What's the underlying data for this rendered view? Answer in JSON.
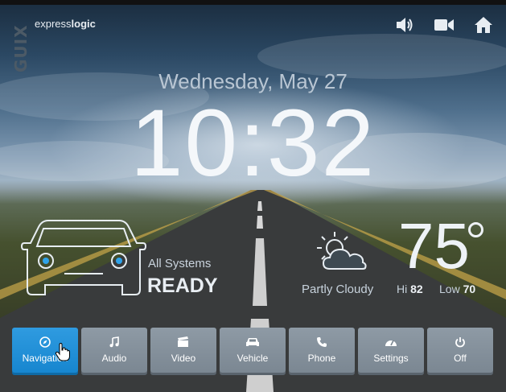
{
  "brand": {
    "badge": "GUIX",
    "name_regular": "express",
    "name_bold": "logic"
  },
  "top_icons": [
    "volume-icon",
    "video-camera-icon",
    "home-icon"
  ],
  "date_text": "Wednesday, May 27",
  "time": {
    "hours": "10",
    "separator": ":",
    "minutes": "32"
  },
  "vehicle_status": {
    "label": "All Systems",
    "status": "READY"
  },
  "weather": {
    "condition": "Partly Cloudy",
    "temperature": "75",
    "hi_label": "Hi",
    "hi_value": "82",
    "lo_label": "Low",
    "lo_value": "70"
  },
  "nav": [
    {
      "label": "Navigation",
      "icon": "compass-icon",
      "active": true
    },
    {
      "label": "Audio",
      "icon": "music-note-icon",
      "active": false
    },
    {
      "label": "Video",
      "icon": "clapperboard-icon",
      "active": false
    },
    {
      "label": "Vehicle",
      "icon": "car-icon",
      "active": false
    },
    {
      "label": "Phone",
      "icon": "phone-icon",
      "active": false
    },
    {
      "label": "Settings",
      "icon": "gauge-icon",
      "active": false
    },
    {
      "label": "Off",
      "icon": "power-icon",
      "active": false
    }
  ],
  "colors": {
    "accent": "#1786cf",
    "button": "#7b8792",
    "text": "#eef2f6"
  }
}
